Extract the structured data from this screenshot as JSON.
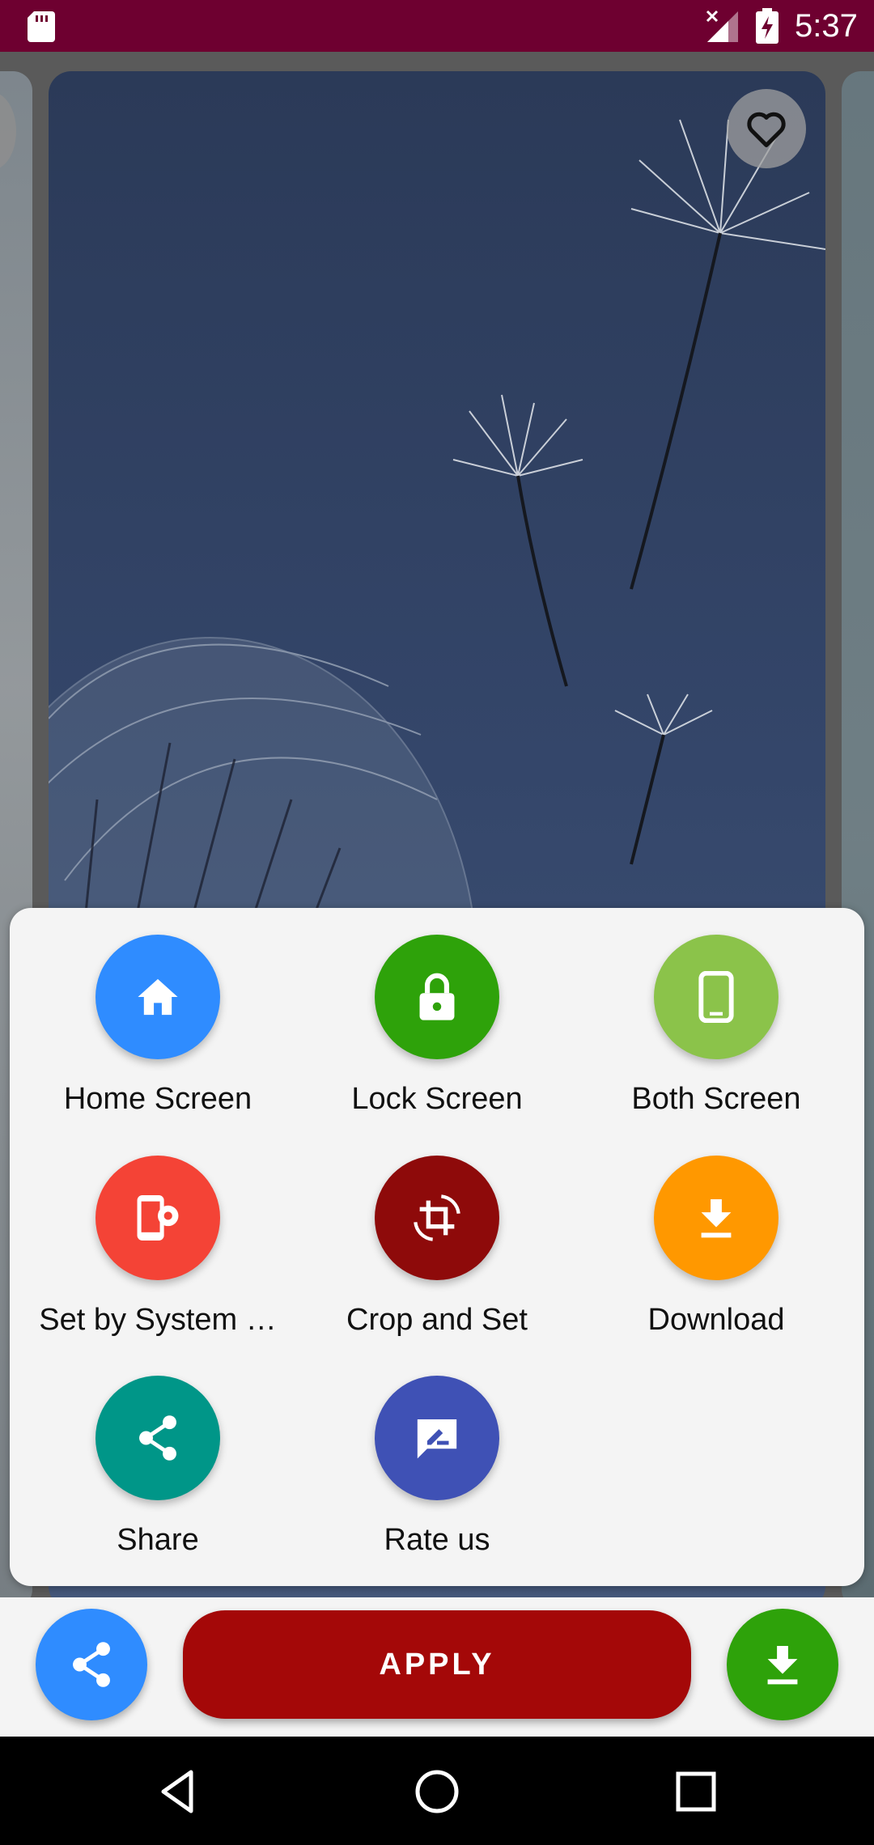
{
  "status_bar": {
    "time": "5:37",
    "icons": [
      "sd-card-icon",
      "signal-off-icon",
      "battery-charging-icon"
    ]
  },
  "viewer": {
    "favorite_icon": "heart-outline-icon"
  },
  "sheet": {
    "options": [
      {
        "label": "Home Screen",
        "icon": "home-icon",
        "color": "#2f8cff"
      },
      {
        "label": "Lock Screen",
        "icon": "lock-icon",
        "color": "#2ea20a"
      },
      {
        "label": "Both Screen",
        "icon": "phone-icon",
        "color": "#8bc34a"
      },
      {
        "label": "Set by System …",
        "icon": "phone-settings-icon",
        "color": "#f44336"
      },
      {
        "label": "Crop and Set",
        "icon": "crop-rotate-icon",
        "color": "#8e0a0a"
      },
      {
        "label": "Download",
        "icon": "download-icon",
        "color": "#ff9800"
      },
      {
        "label": "Share",
        "icon": "share-icon",
        "color": "#009688"
      },
      {
        "label": "Rate us",
        "icon": "rate-review-icon",
        "color": "#3f51b5"
      }
    ]
  },
  "action_bar": {
    "apply_label": "APPLY",
    "apply_color": "#a40808",
    "share_color": "#2f8cff",
    "download_color": "#2ea20a"
  },
  "colors": {
    "status_bar": "#6e0030",
    "sheet_background": "#f4f4f4"
  }
}
